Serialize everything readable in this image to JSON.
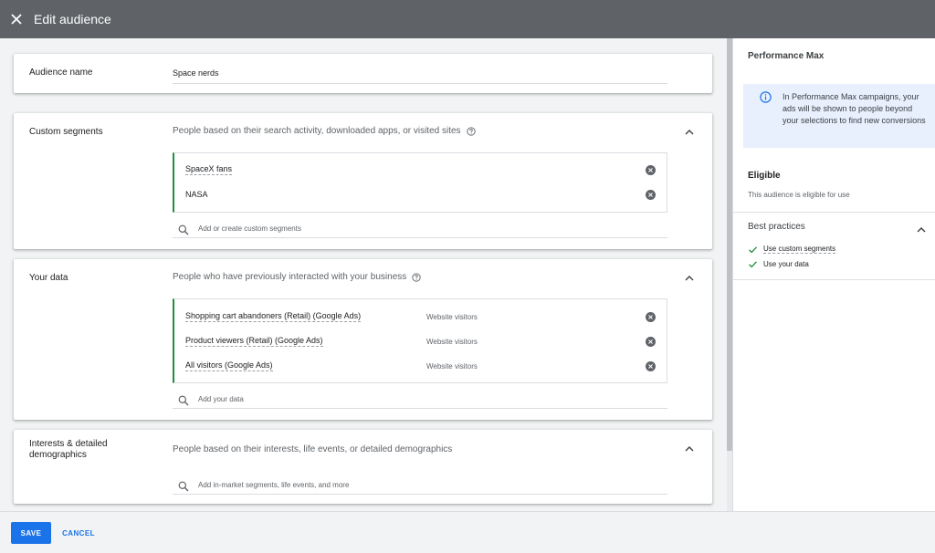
{
  "header": {
    "title": "Edit audience",
    "close_icon": "close-icon"
  },
  "audience_name": {
    "label": "Audience name",
    "value": "Space nerds"
  },
  "custom_segments": {
    "label": "Custom segments",
    "description": "People based on their search activity, downloaded apps, or visited sites",
    "items": [
      {
        "name": "SpaceX fans"
      },
      {
        "name": "NASA"
      }
    ],
    "search_placeholder": "Add or create custom segments"
  },
  "your_data": {
    "label": "Your data",
    "description": "People who have previously interacted with your business",
    "items": [
      {
        "name": "Shopping cart abandoners (Retail) (Google Ads)",
        "type": "Website visitors"
      },
      {
        "name": "Product viewers (Retail) (Google Ads)",
        "type": "Website visitors"
      },
      {
        "name": "All visitors (Google Ads)",
        "type": "Website visitors"
      }
    ],
    "search_placeholder": "Add your data"
  },
  "interests": {
    "label_line1": "Interests & detailed",
    "label_line2": "demographics",
    "description": "People based on their interests, life events, or detailed demographics",
    "search_placeholder": "Add in-market segments, life events, and more"
  },
  "side_panel": {
    "title": "Performance Max",
    "info_text": "In Performance Max campaigns, your ads will be shown to people beyond your selections to find new conversions",
    "eligible_title": "Eligible",
    "eligible_sub": "This audience is eligible for use",
    "best_practices_title": "Best practices",
    "best_practices": [
      "Use custom segments",
      "Use your data"
    ]
  },
  "footer": {
    "save_label": "SAVE",
    "cancel_label": "CANCEL"
  },
  "colors": {
    "topbar": "#5f6368",
    "accent": "#1a73e8",
    "success": "#1e8e3e",
    "info_bg": "#e8f0fe"
  }
}
